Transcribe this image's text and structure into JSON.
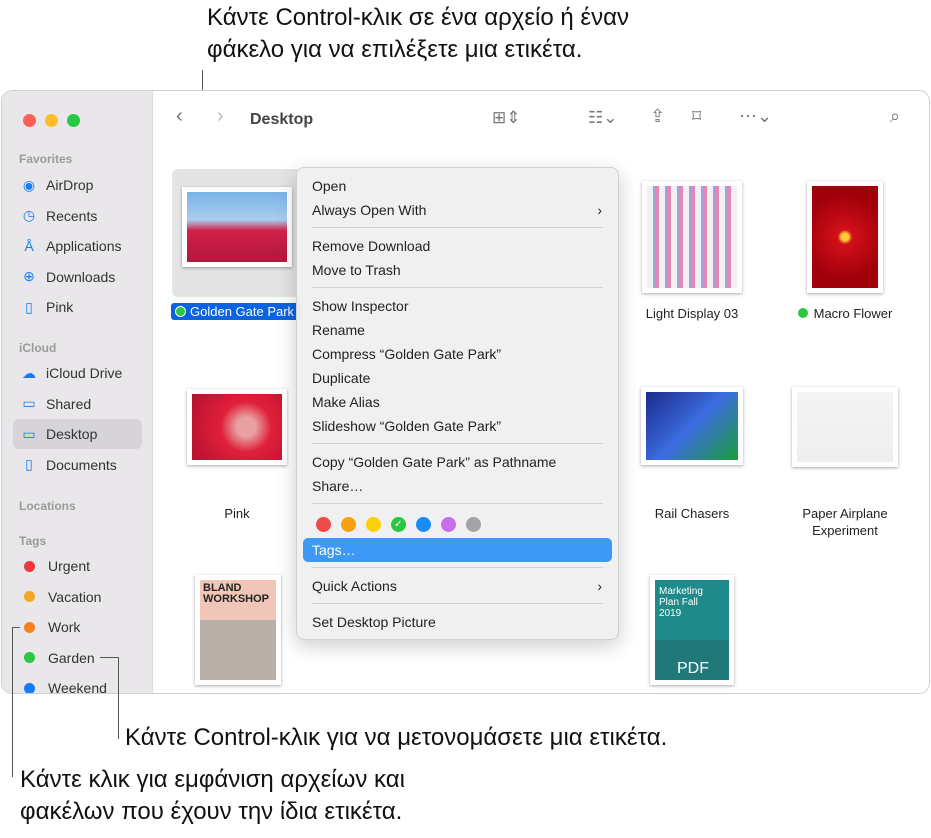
{
  "callouts": {
    "top": [
      "Κάντε Control-κλικ σε ένα αρχείο ή έναν",
      "φάκελο για να επιλέξετε μια ετικέτα."
    ],
    "rename": "Κάντε Control-κλικ για να μετονομάσετε μια ετικέτα.",
    "show": [
      "Κάντε κλικ για εμφάνιση αρχείων και",
      "φακέλων που έχουν την ίδια ετικέτα."
    ]
  },
  "window": {
    "title": "Desktop"
  },
  "sidebar": {
    "favorites_header": "Favorites",
    "favorites": [
      {
        "label": "AirDrop",
        "icon": "airdrop-icon"
      },
      {
        "label": "Recents",
        "icon": "clock-icon"
      },
      {
        "label": "Applications",
        "icon": "applications-icon"
      },
      {
        "label": "Downloads",
        "icon": "download-icon"
      },
      {
        "label": "Pink",
        "icon": "document-icon"
      }
    ],
    "icloud_header": "iCloud",
    "icloud": [
      {
        "label": "iCloud Drive",
        "icon": "cloud-icon"
      },
      {
        "label": "Shared",
        "icon": "shared-folder-icon"
      },
      {
        "label": "Desktop",
        "icon": "desktop-icon",
        "selected": true
      },
      {
        "label": "Documents",
        "icon": "document-icon"
      }
    ],
    "locations_header": "Locations",
    "tags_header": "Tags",
    "tags": [
      {
        "label": "Urgent",
        "color": "#f0353d"
      },
      {
        "label": "Vacation",
        "color": "#f5a623"
      },
      {
        "label": "Work",
        "color": "#f7821b"
      },
      {
        "label": "Garden",
        "color": "#28c840"
      },
      {
        "label": "Weekend",
        "color": "#1a7cf5"
      }
    ]
  },
  "files": [
    {
      "name": "Golden Gate Park",
      "tag": "#28c840",
      "selected": true
    },
    {
      "name": "Light Display 03"
    },
    {
      "name": "Macro Flower",
      "tag": "#28c840"
    },
    {
      "name": "Pink"
    },
    {
      "name": "Rail Chasers"
    },
    {
      "name": "Paper Airplane Experiment"
    },
    {
      "name": "BLAND WORKSHOP"
    },
    {
      "name": "Marketing Plan Fall 2019"
    }
  ],
  "menu": {
    "groups": [
      [
        {
          "label": "Open"
        },
        {
          "label": "Always Open With",
          "submenu": true
        }
      ],
      [
        {
          "label": "Remove Download"
        },
        {
          "label": "Move to Trash"
        }
      ],
      [
        {
          "label": "Show Inspector"
        },
        {
          "label": "Rename"
        },
        {
          "label": "Compress “Golden Gate Park”"
        },
        {
          "label": "Duplicate"
        },
        {
          "label": "Make Alias"
        },
        {
          "label": "Slideshow “Golden Gate Park”"
        }
      ],
      [
        {
          "label": "Copy “Golden Gate Park” as Pathname"
        },
        {
          "label": "Share…"
        }
      ]
    ],
    "tag_colors": [
      "#f04a4a",
      "#f7a012",
      "#fbd10a",
      "#28c840",
      "#1a8cf5",
      "#c86ee8",
      "#a4a4a8"
    ],
    "checked_color": "#28c840",
    "tags_item": "Tags…",
    "quick_actions": "Quick Actions",
    "set_desktop": "Set Desktop Picture"
  },
  "pdf_label": "PDF"
}
